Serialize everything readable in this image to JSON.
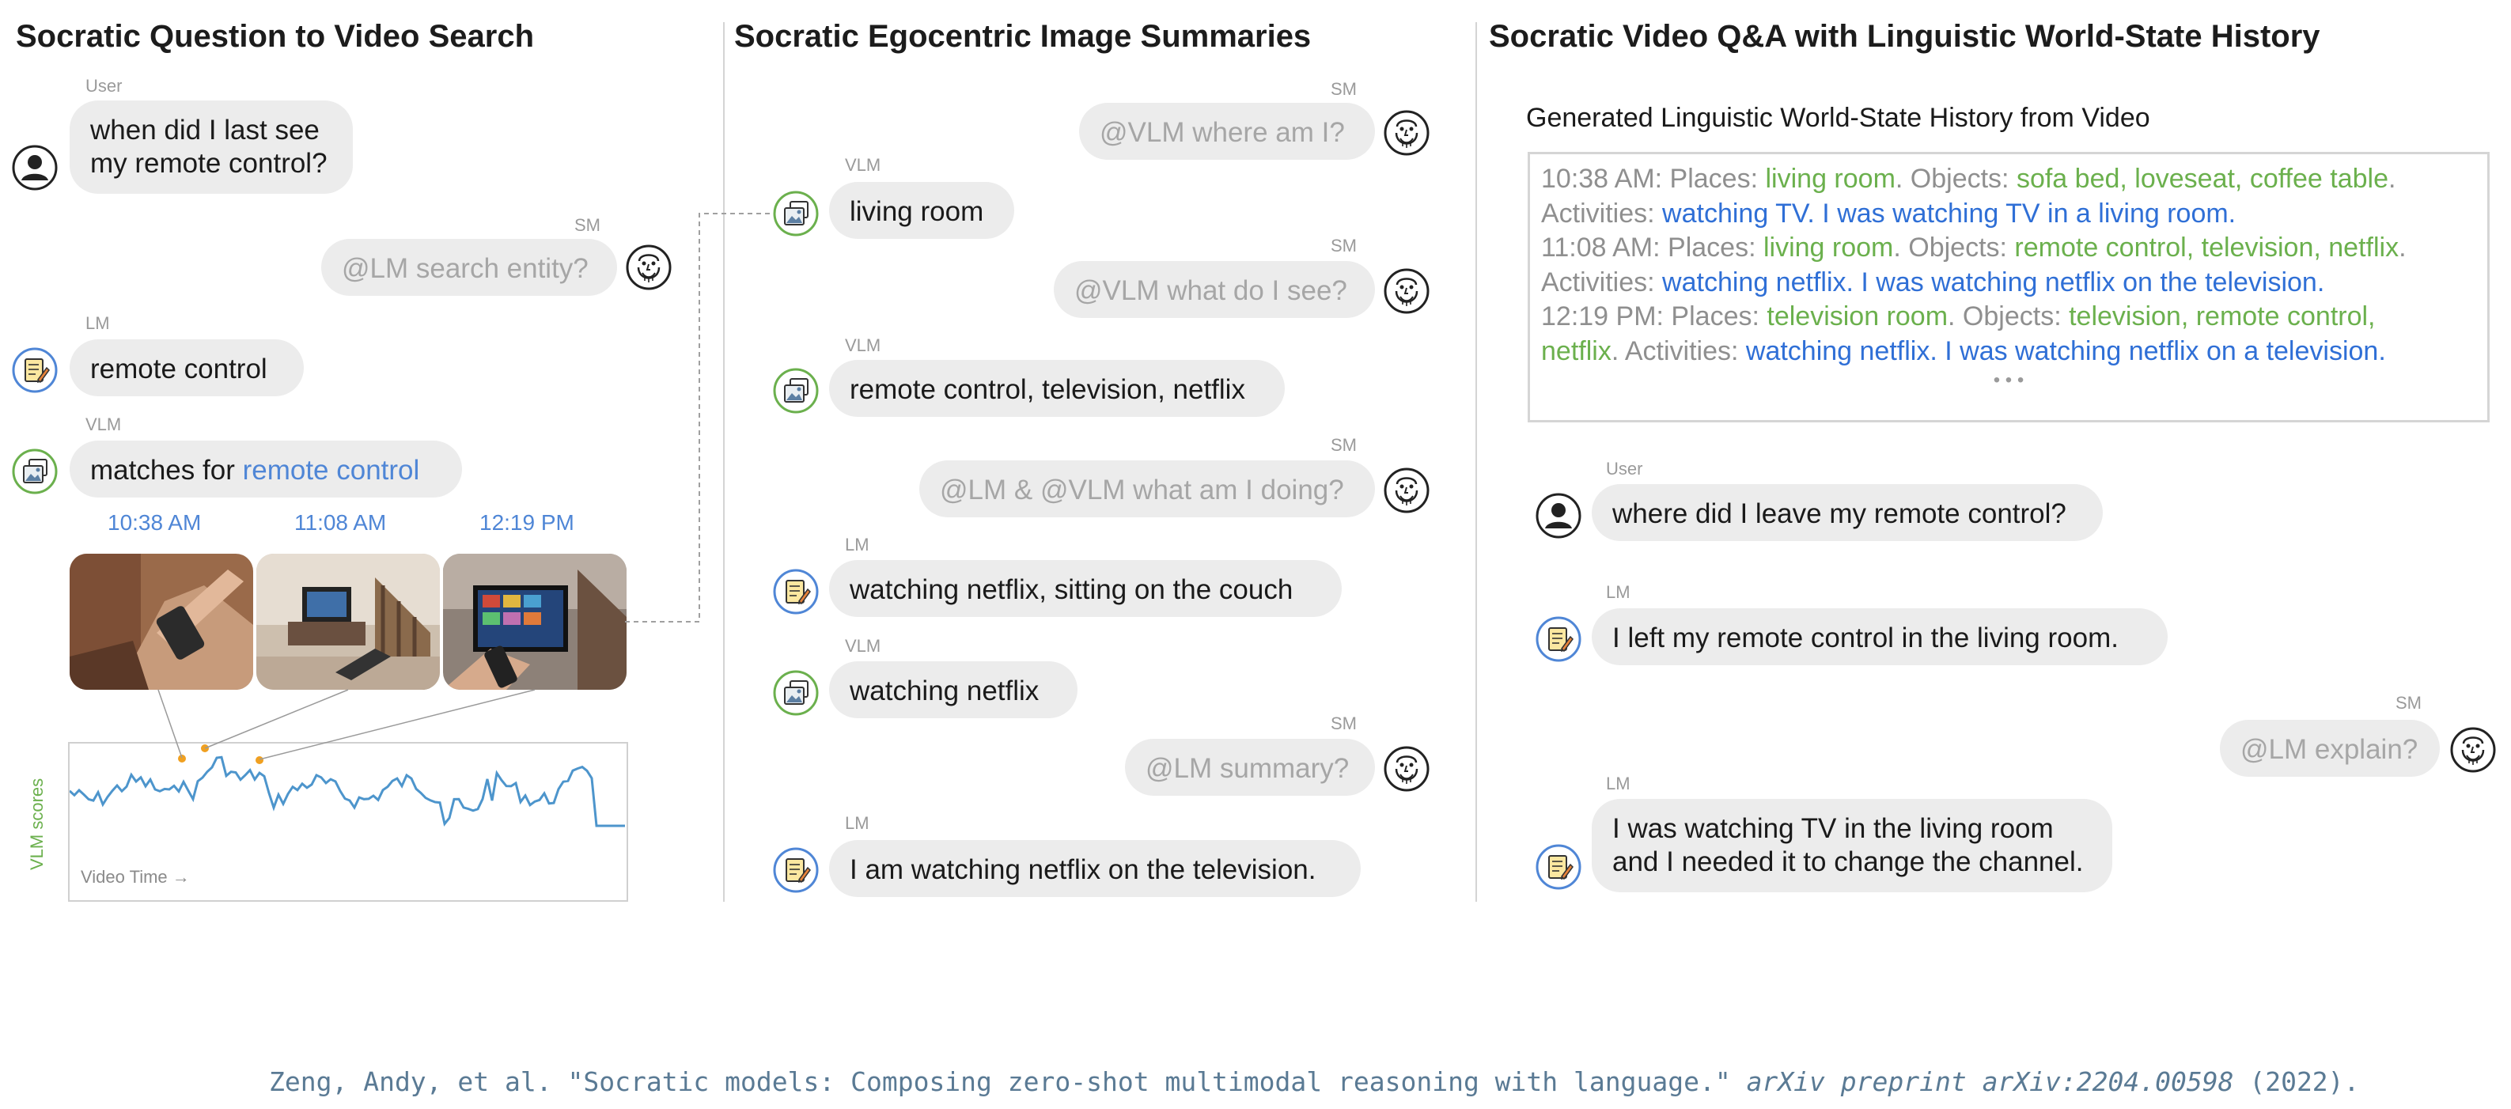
{
  "panels": {
    "left_title": "Socratic Question to Video Search",
    "middle_title": "Socratic Egocentric Image Summaries",
    "right_title": "Socratic Video Q&A with Linguistic World-State History"
  },
  "left": {
    "msg1": {
      "speaker": "User",
      "text_line1": "when did I last see",
      "text_line2": "my remote control?"
    },
    "msg2": {
      "speaker": "SM",
      "text": "@LM search entity?"
    },
    "msg3": {
      "speaker": "LM",
      "text": "remote control"
    },
    "msg4": {
      "speaker": "VLM",
      "text_prefix": "matches for ",
      "text_link": "remote control"
    },
    "times": [
      "10:38 AM",
      "11:08 AM",
      "12:19 PM"
    ],
    "plot": {
      "ylabel": "VLM scores",
      "xlabel": "Video Time →"
    }
  },
  "middle": {
    "msgs": [
      {
        "speaker": "SM",
        "text": "@VLM where am I?"
      },
      {
        "speaker": "VLM",
        "text": "living room"
      },
      {
        "speaker": "SM",
        "text": "@VLM what do I see?"
      },
      {
        "speaker": "VLM",
        "text": "remote control, television, netflix"
      },
      {
        "speaker": "SM",
        "text": "@LM & @VLM what am I doing?"
      },
      {
        "speaker": "LM",
        "text": "watching netflix, sitting on the couch"
      },
      {
        "speaker": "VLM",
        "text": "watching netflix"
      },
      {
        "speaker": "SM",
        "text": "@LM summary?"
      },
      {
        "speaker": "LM",
        "text": "I am watching netflix on the television."
      }
    ]
  },
  "right": {
    "history_title": "Generated Linguistic World-State History from Video",
    "history": {
      "e1_time": "10:38 AM: Places: ",
      "e1_place": "living room",
      "e1_objects_label": ". Objects: ",
      "e1_objects": "sofa bed, loveseat, coffee table",
      "e1_act_label": ". Activities: ",
      "e1_act": "watching TV",
      "e1_sentence": ". I was watching TV in a living room.",
      "e2_time": "11:08 AM: Places: ",
      "e2_place": "living room",
      "e2_objects_label": ". Objects: ",
      "e2_objects": "remote control, television, netflix",
      "e2_act_label": ". Activities: ",
      "e2_act": "watching netflix",
      "e2_sentence": ". I was watching netflix on the television.",
      "e3_time": "12:19 PM: Places: ",
      "e3_place": "television room",
      "e3_objects_label": ". Objects: ",
      "e3_objects_a": "television, remote control,",
      "e3_objects_b": "netflix",
      "e3_act_label": ". Activities: ",
      "e3_act": "watching netflix",
      "e3_sentence": ". I was watching netflix on a television.",
      "ellipsis": "• • •"
    },
    "msgs": [
      {
        "speaker": "User",
        "text": "where did I leave my remote control?"
      },
      {
        "speaker": "LM",
        "text": "I left my remote control in the living room."
      },
      {
        "speaker": "SM",
        "text": "@LM explain?"
      },
      {
        "speaker": "LM",
        "text_line1": "I was watching TV in the living room",
        "text_line2": "and I needed it to change the channel."
      }
    ]
  },
  "citation": {
    "authors": "Zeng, Andy, et al. \"Socratic models: Composing zero-shot multimodal reasoning with language.\" ",
    "venue": "arXiv preprint arXiv:2204.00598",
    "year": " (2022)."
  },
  "icons": {
    "user": "user-avatar-icon",
    "sm": "socrates-face-icon",
    "lm": "notepad-pencil-icon",
    "vlm": "image-stack-icon"
  },
  "colors": {
    "link_blue": "#4f86d6",
    "history_green": "#6bb04d",
    "history_blue": "#2f6fd6",
    "lm_ring": "#4f86d6",
    "vlm_ring": "#6bb04d"
  }
}
